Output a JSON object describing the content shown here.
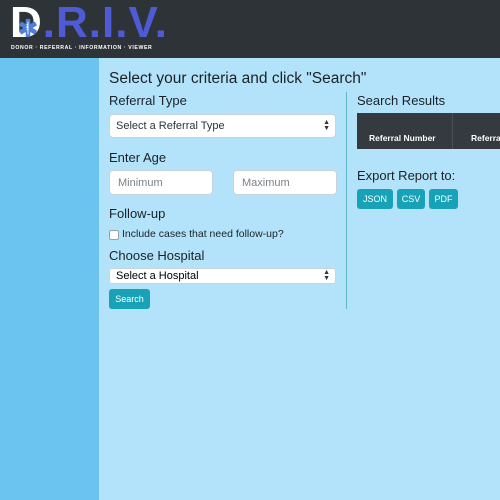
{
  "app": {
    "logo_letters_d": "D",
    "logo_letters_rest": ".R.I.V.",
    "logo_tagline": "DONOR · REFERRAL · INFORMATION · VIEWER"
  },
  "page_title": "Select your criteria and click \"Search\"",
  "referral_type": {
    "label": "Referral Type",
    "selected": "Select a Referral Type"
  },
  "age": {
    "label": "Enter Age",
    "min_placeholder": "Minimum",
    "max_placeholder": "Maximum"
  },
  "followup": {
    "label": "Follow-up",
    "checkbox_label": "Include cases that need follow-up?"
  },
  "hospital": {
    "label": "Choose Hospital",
    "selected": "Select a Hospital"
  },
  "search_button": "Search",
  "results": {
    "title": "Search Results",
    "columns": [
      "Referral Number",
      "Referra"
    ]
  },
  "export": {
    "title": "Export Report to:",
    "buttons": [
      "JSON",
      "CSV",
      "PDF"
    ]
  },
  "colors": {
    "topbar": "#2e3338",
    "sidebar": "#6bc4ef",
    "main_bg": "#b2e3fb",
    "accent": "#17a2b8",
    "logo_blue": "#4f5bd5",
    "table_header": "#343a40"
  }
}
